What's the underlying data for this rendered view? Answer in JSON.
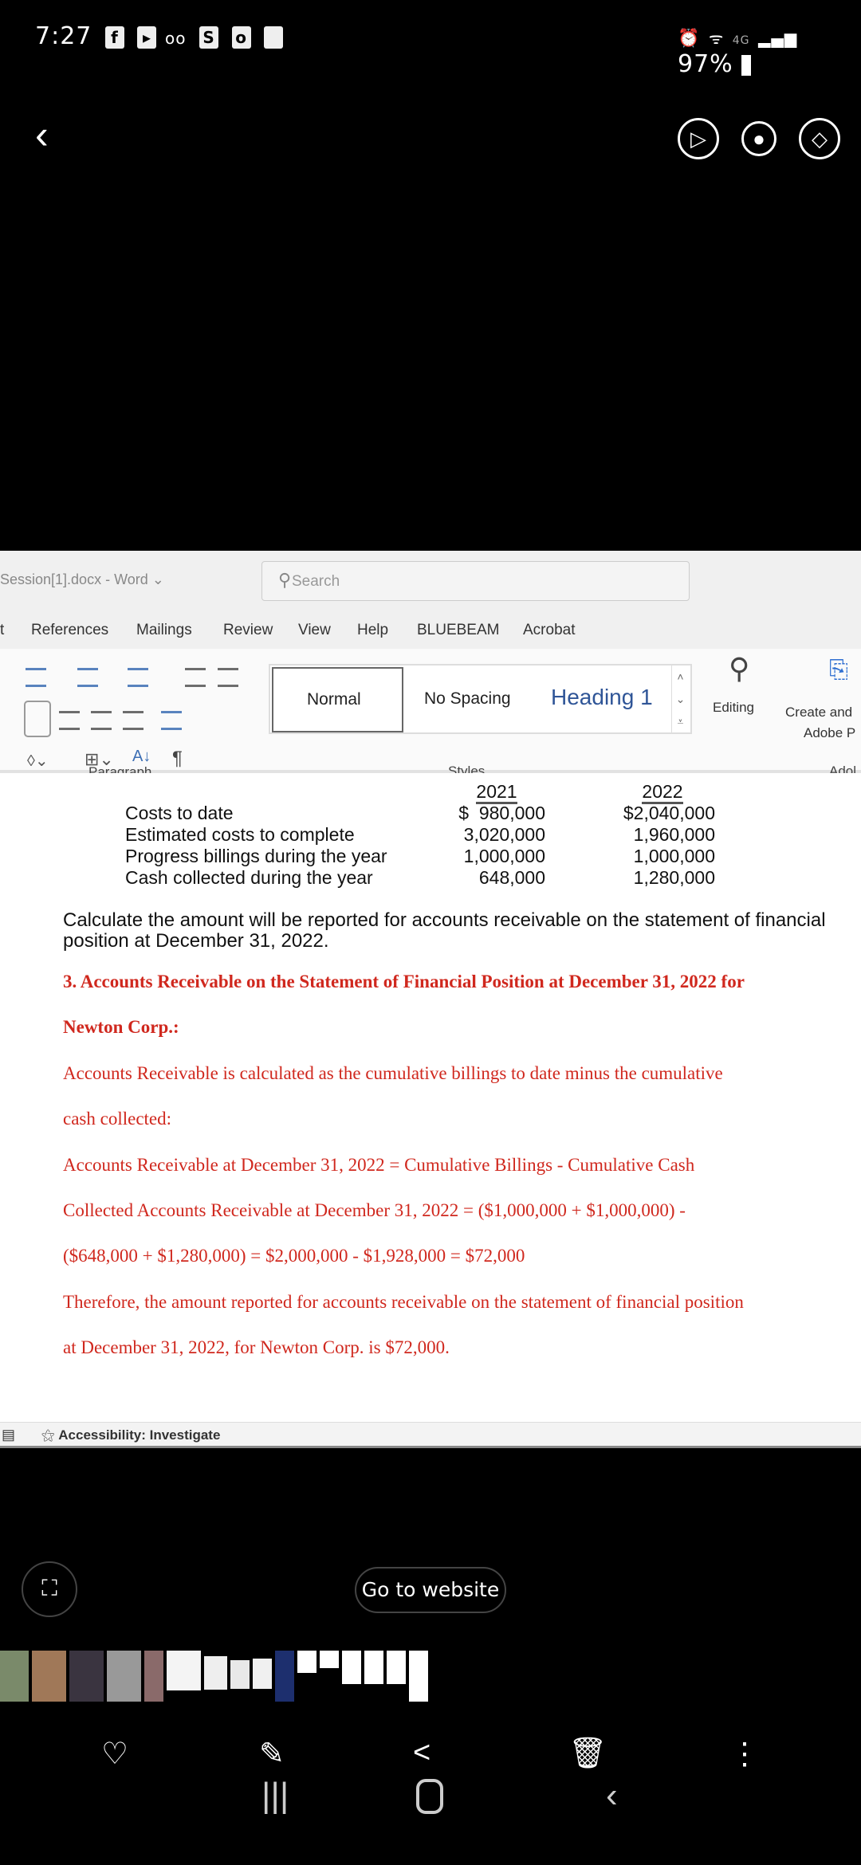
{
  "status_bar": {
    "time": "7:27",
    "battery": "97%",
    "network": "4G"
  },
  "viewer": {
    "go_to_website": "Go to website"
  },
  "word": {
    "doc_title": "Session[1].docx",
    "app_name": "Word",
    "search_placeholder": "Search",
    "tabs": [
      "t",
      "References",
      "Mailings",
      "Review",
      "View",
      "Help",
      "BLUEBEAM",
      "Acrobat"
    ],
    "ribbon": {
      "paragraph_label": "Paragraph",
      "styles_label": "Styles",
      "styles": [
        "Normal",
        "No Spacing",
        "Heading 1"
      ],
      "editing": "Editing",
      "create_line1": "Create and",
      "create_line2": "Adobe P",
      "adobe_group": "Adol"
    },
    "status": {
      "accessibility": "Accessibility: Investigate"
    }
  },
  "document": {
    "table": {
      "headers": [
        "2021",
        "2022"
      ],
      "rows": [
        {
          "label": "Costs to date",
          "y2021": "$  980,000",
          "y2022": "$2,040,000"
        },
        {
          "label": "Estimated costs to complete",
          "y2021": "3,020,000",
          "y2022": "1,960,000"
        },
        {
          "label": "Progress billings during the year",
          "y2021": "1,000,000",
          "y2022": "1,000,000"
        },
        {
          "label": "Cash collected during the year",
          "y2021": "648,000",
          "y2022": "1,280,000"
        }
      ]
    },
    "question": [
      "Calculate the amount will be reported for accounts receivable on the statement of financial",
      "position at December 31, 2022."
    ],
    "answer_heading": [
      "3. Accounts Receivable on the Statement of Financial Position at December 31, 2022 for",
      "Newton Corp.:"
    ],
    "answer_lines": [
      "Accounts Receivable is calculated as the cumulative billings to date minus the cumulative",
      "cash collected:",
      "Accounts Receivable at December 31, 2022 = Cumulative Billings - Cumulative Cash",
      "Collected Accounts Receivable at December 31, 2022 = ($1,000,000 + $1,000,000) -",
      "($648,000 + $1,280,000) = $2,000,000 - $1,928,000 = $72,000",
      "Therefore, the amount reported for accounts receivable on the statement of financial position",
      "at December 31, 2022, for Newton Corp. is $72,000."
    ],
    "answer_color": "#d0281e"
  },
  "icons": {
    "back": "chevron-left-icon",
    "favorite": "heart-icon",
    "edit": "pencil-icon",
    "share": "share-icon",
    "delete": "trash-icon",
    "more": "more-vertical-icon"
  }
}
